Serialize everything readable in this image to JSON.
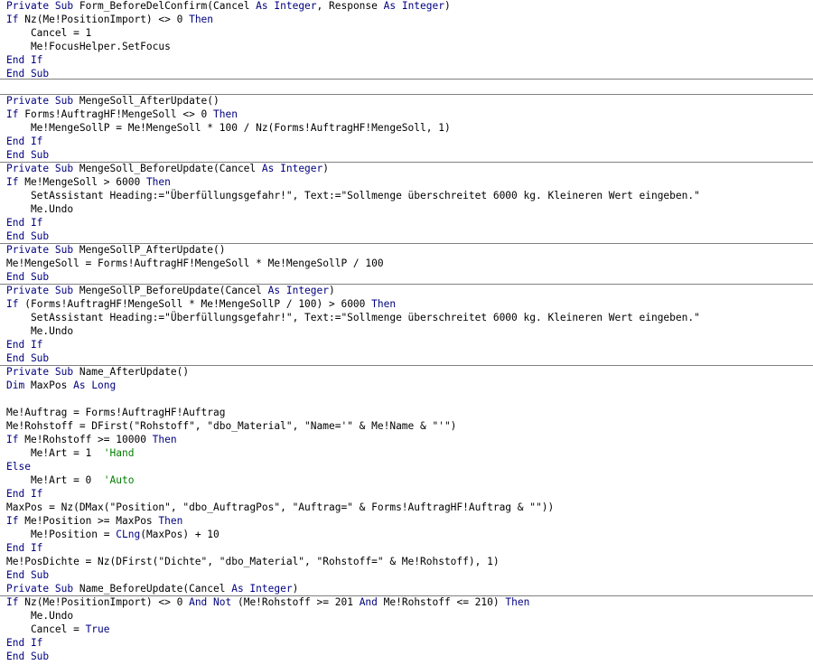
{
  "editor": {
    "lines": [
      [
        {
          "t": "Private Sub ",
          "k": 1
        },
        {
          "t": "Form_BeforeDelConfirm("
        },
        {
          "t": "Cancel ",
          "k": 0
        },
        {
          "t": "As Integer",
          "k": 1
        },
        {
          "t": ", Response "
        },
        {
          "t": "As Integer",
          "k": 1
        },
        {
          "t": ")"
        }
      ],
      [
        {
          "t": "If ",
          "k": 1
        },
        {
          "t": "Nz(Me!PositionImport) <> 0 "
        },
        {
          "t": "Then",
          "k": 1
        }
      ],
      [
        {
          "t": "    Cancel = 1"
        }
      ],
      [
        {
          "t": "    Me!FocusHelper.SetFocus"
        }
      ],
      [
        {
          "t": "End If",
          "k": 1
        }
      ],
      [
        {
          "t": "End Sub",
          "k": 1
        }
      ],
      [
        {
          "t": ""
        }
      ],
      [
        {
          "t": "Private Sub ",
          "k": 1
        },
        {
          "t": "MengeSoll_AfterUpdate()"
        }
      ],
      [
        {
          "t": "If ",
          "k": 1
        },
        {
          "t": "Forms!AuftragHF!MengeSoll <> 0 "
        },
        {
          "t": "Then",
          "k": 1
        }
      ],
      [
        {
          "t": "    Me!MengeSollP = Me!MengeSoll * 100 / Nz(Forms!AuftragHF!MengeSoll, 1)"
        }
      ],
      [
        {
          "t": "End If",
          "k": 1
        }
      ],
      [
        {
          "t": "End Sub",
          "k": 1
        }
      ],
      [
        {
          "t": "Private Sub ",
          "k": 1
        },
        {
          "t": "MengeSoll_BeforeUpdate(Cancel "
        },
        {
          "t": "As Integer",
          "k": 1
        },
        {
          "t": ")"
        }
      ],
      [
        {
          "t": "If ",
          "k": 1
        },
        {
          "t": "Me!MengeSoll > 6000 "
        },
        {
          "t": "Then",
          "k": 1
        }
      ],
      [
        {
          "t": "    SetAssistant Heading:=\"Überfüllungsgefahr!\", Text:=\"Sollmenge überschreitet 6000 kg. Kleineren Wert eingeben.\""
        }
      ],
      [
        {
          "t": "    Me.Undo"
        }
      ],
      [
        {
          "t": "End If",
          "k": 1
        }
      ],
      [
        {
          "t": "End Sub",
          "k": 1
        }
      ],
      [
        {
          "t": "Private Sub ",
          "k": 1
        },
        {
          "t": "MengeSollP_AfterUpdate()"
        }
      ],
      [
        {
          "t": "Me!MengeSoll = Forms!AuftragHF!MengeSoll * Me!MengeSollP / 100"
        }
      ],
      [
        {
          "t": "End Sub",
          "k": 1
        }
      ],
      [
        {
          "t": "Private Sub ",
          "k": 1
        },
        {
          "t": "MengeSollP_BeforeUpdate(Cancel "
        },
        {
          "t": "As Integer",
          "k": 1
        },
        {
          "t": ")"
        }
      ],
      [
        {
          "t": "If ",
          "k": 1
        },
        {
          "t": "(Forms!AuftragHF!MengeSoll * Me!MengeSollP / 100) > 6000 "
        },
        {
          "t": "Then",
          "k": 1
        }
      ],
      [
        {
          "t": "    SetAssistant Heading:=\"Überfüllungsgefahr!\", Text:=\"Sollmenge überschreitet 6000 kg. Kleineren Wert eingeben.\""
        }
      ],
      [
        {
          "t": "    Me.Undo"
        }
      ],
      [
        {
          "t": "End If",
          "k": 1
        }
      ],
      [
        {
          "t": "End Sub",
          "k": 1
        }
      ],
      [
        {
          "t": "Private Sub ",
          "k": 1
        },
        {
          "t": "Name_AfterUpdate()"
        }
      ],
      [
        {
          "t": "Dim ",
          "k": 1
        },
        {
          "t": "MaxPos "
        },
        {
          "t": "As Long",
          "k": 1
        }
      ],
      [
        {
          "t": ""
        }
      ],
      [
        {
          "t": "Me!Auftrag = Forms!AuftragHF!Auftrag"
        }
      ],
      [
        {
          "t": "Me!Rohstoff = DFirst(\"Rohstoff\", \"dbo_Material\", \"Name='\" & Me!Name & \"'\")"
        }
      ],
      [
        {
          "t": "If ",
          "k": 1
        },
        {
          "t": "Me!Rohstoff >= 10000 "
        },
        {
          "t": "Then",
          "k": 1
        }
      ],
      [
        {
          "t": "    Me!Art = 1  "
        },
        {
          "t": "'Hand",
          "c": 1
        }
      ],
      [
        {
          "t": "Else",
          "k": 1
        }
      ],
      [
        {
          "t": "    Me!Art = 0  "
        },
        {
          "t": "'Auto",
          "c": 1
        }
      ],
      [
        {
          "t": "End If",
          "k": 1
        }
      ],
      [
        {
          "t": "MaxPos = Nz(DMax(\"Position\", \"dbo_AuftragPos\", \"Auftrag=\" & Forms!AuftragHF!Auftrag & \"\"))"
        }
      ],
      [
        {
          "t": "If ",
          "k": 1
        },
        {
          "t": "Me!Position >= MaxPos "
        },
        {
          "t": "Then",
          "k": 1
        }
      ],
      [
        {
          "t": "    Me!Position = "
        },
        {
          "t": "CLng",
          "k": 1
        },
        {
          "t": "(MaxPos) + 10"
        }
      ],
      [
        {
          "t": "End If",
          "k": 1
        }
      ],
      [
        {
          "t": "Me!PosDichte = Nz(DFirst(\"Dichte\", \"dbo_Material\", \"Rohstoff=\" & Me!Rohstoff), 1)"
        }
      ],
      [
        {
          "t": "End Sub",
          "k": 1
        }
      ],
      [
        {
          "t": "Private Sub ",
          "k": 1
        },
        {
          "t": "Name_BeforeUpdate(Cancel "
        },
        {
          "t": "As Integer",
          "k": 1
        },
        {
          "t": ")"
        }
      ],
      [
        {
          "t": "If ",
          "k": 1
        },
        {
          "t": "Nz(Me!PositionImport) <> 0 "
        },
        {
          "t": "And Not",
          "k": 1
        },
        {
          "t": " (Me!Rohstoff >= 201 "
        },
        {
          "t": "And",
          "k": 1
        },
        {
          "t": " Me!Rohstoff <= 210) "
        },
        {
          "t": "Then",
          "k": 1
        }
      ],
      [
        {
          "t": "    Me.Undo"
        }
      ],
      [
        {
          "t": "    Cancel = "
        },
        {
          "t": "True",
          "k": 1
        }
      ],
      [
        {
          "t": "End If",
          "k": 1
        }
      ],
      [
        {
          "t": "End Sub",
          "k": 1
        }
      ]
    ],
    "colors": {
      "keyword": "#00007f",
      "comment": "#007f00",
      "text": "#000000",
      "separator": "#808080",
      "background": "#ffffff"
    }
  }
}
